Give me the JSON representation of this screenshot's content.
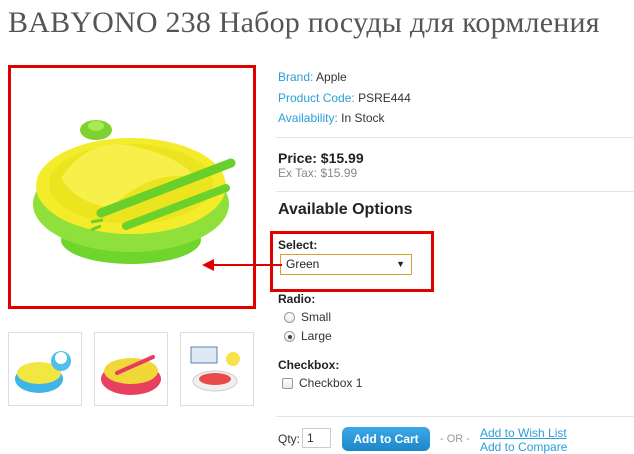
{
  "product": {
    "title": "BABYONO 238 Набор посуды для кормления",
    "brand_label": "Brand:",
    "brand_value": "Apple",
    "code_label": "Product Code:",
    "code_value": "PSRE444",
    "availability_label": "Availability:",
    "availability_value": "In Stock",
    "price": "Price: $15.99",
    "ex_tax": "Ex Tax: $15.99"
  },
  "options": {
    "heading": "Available Options",
    "select_label": "Select:",
    "select_value": "Green",
    "radio_label": "Radio:",
    "radio_options": [
      {
        "label": "Small",
        "checked": false
      },
      {
        "label": "Large",
        "checked": true
      }
    ],
    "checkbox_label": "Checkbox:",
    "checkbox_options": [
      {
        "label": "Checkbox 1",
        "checked": false
      }
    ]
  },
  "cart": {
    "qty_label": "Qty:",
    "qty_value": "1",
    "add_button": "Add to Cart",
    "or_text": "- OR -",
    "wishlist": "Add to Wish List",
    "compare": "Add to Compare"
  },
  "colors": {
    "highlight": "#e00000",
    "link": "#2a9fd6",
    "button": "#2391d6"
  }
}
